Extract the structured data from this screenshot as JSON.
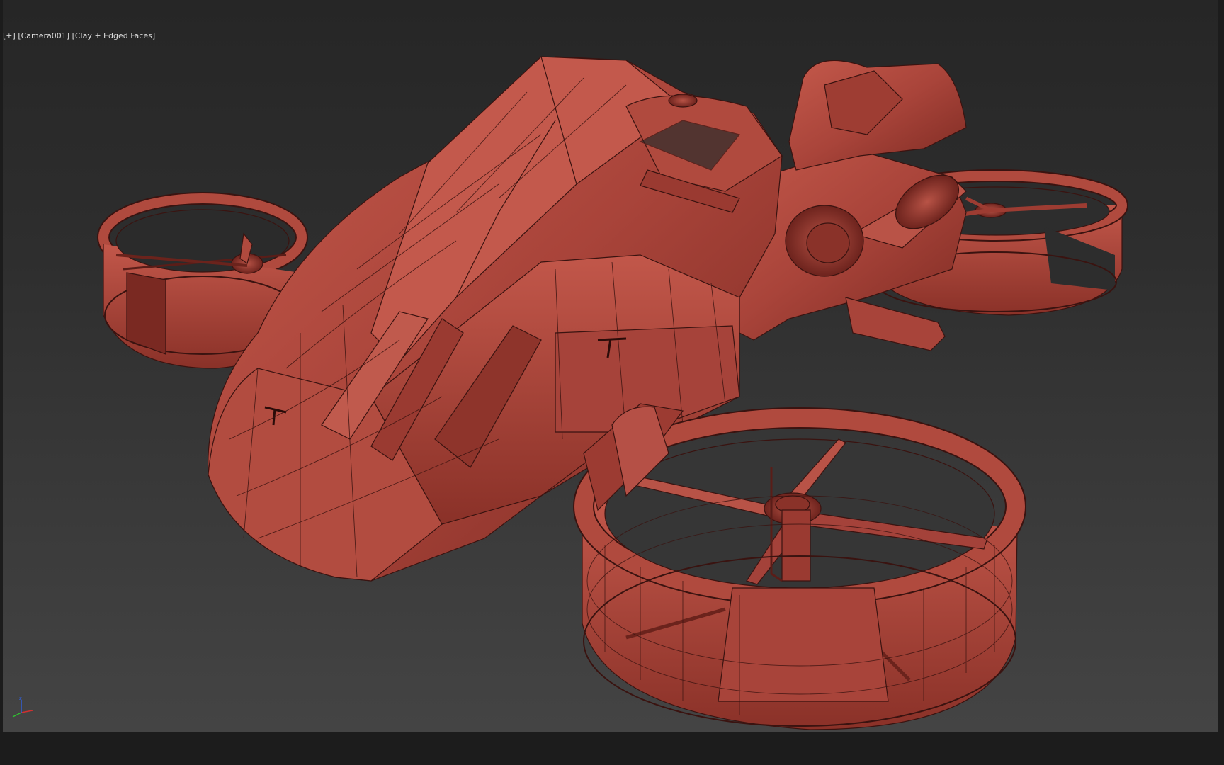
{
  "viewport": {
    "label_plus": "[+]",
    "label_camera": "[Camera001]",
    "label_shading": "[Clay + Edged Faces]"
  },
  "model": {
    "name": "flying-hover-bike",
    "base_color": "#b5483c",
    "edge_color": "#3a1310"
  },
  "gizmo": {
    "axis_label_z": "z"
  },
  "colors": {
    "viewport_top": "#262626",
    "viewport_bottom": "#444444",
    "frame": "#1c1c1c",
    "axis_x": "#d03030",
    "axis_y": "#30c030",
    "axis_z": "#3060e0"
  }
}
